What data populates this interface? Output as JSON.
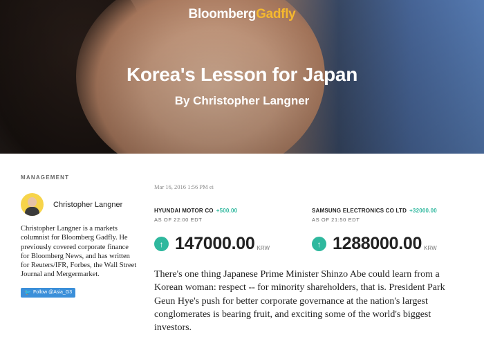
{
  "brand": {
    "part1": "Bloomberg",
    "part2": "Gadfly"
  },
  "hero": {
    "headline": "Korea's Lesson for Japan",
    "byline": "By Christopher Langner"
  },
  "sidebar": {
    "section_label": "MANAGEMENT",
    "author_name": "Christopher Langner",
    "bio": "Christopher Langner is a markets columnist for Bloomberg Gadfly. He previously covered corporate finance for Bloomberg News, and has written for Reuters/IFR, Forbes, the Wall Street Journal and Mergermarket.",
    "follow_label": "Follow @Asia_G3",
    "follow_icon": "twitter-bird-icon"
  },
  "main": {
    "timestamp": "Mar 16, 2016 1:56 PM",
    "timestamp_icon": "ei",
    "stocks": [
      {
        "name": "HYUNDAI MOTOR CO",
        "change": "+500.00",
        "as_of": "AS OF 22:00 EDT",
        "price": "147000.00",
        "currency": "KRW",
        "direction_icon": "up-arrow-icon"
      },
      {
        "name": "SAMSUNG ELECTRONICS CO LTD",
        "change": "+32000.00",
        "as_of": "AS OF 21:50 EDT",
        "price": "1288000.00",
        "currency": "KRW",
        "direction_icon": "up-arrow-icon"
      }
    ],
    "article_text": "There's one thing Japanese Prime Minister Shinzo Abe could learn from a Korean woman: respect -- for minority shareholders, that is. President Park Geun Hye's push for better corporate governance at the nation's largest conglomerates is bearing fruit, and exciting some of the world's biggest investors."
  },
  "colors": {
    "gadfly_accent": "#f5b82e",
    "positive": "#2fb89e",
    "twitter_button": "#3b8fd9"
  }
}
